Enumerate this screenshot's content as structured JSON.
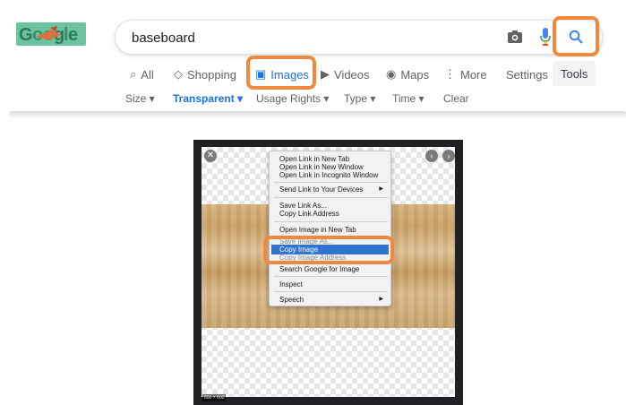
{
  "search": {
    "query": "baseboard"
  },
  "nav": {
    "all": "All",
    "shopping": "Shopping",
    "images": "Images",
    "videos": "Videos",
    "maps": "Maps",
    "more": "More",
    "settings": "Settings",
    "tools": "Tools"
  },
  "filters": {
    "size": "Size ▾",
    "transparent": "Transparent ▾",
    "usage_rights": "Usage Rights ▾",
    "type": "Type ▾",
    "time": "Time ▾",
    "clear": "Clear"
  },
  "context_menu": {
    "items": [
      "Open Link in New Tab",
      "Open Link in New Window",
      "Open Link in Incognito Window",
      "Send Link to Your Devices",
      "Save Link As...",
      "Copy Link Address",
      "Open Image in New Tab",
      "Save Image As...",
      "Copy Image",
      "Copy Image Address",
      "Search Google for Image",
      "Inspect",
      "Speech"
    ]
  },
  "viewer": {
    "dimensions": "600 × 600"
  },
  "colors": {
    "highlight": "#f0883e",
    "accent": "#1a73e8",
    "menu_selection": "#2f74d0"
  },
  "icons": [
    "search-icon",
    "camera-icon",
    "mic-icon",
    "close-icon",
    "chevron-left-icon",
    "chevron-right-icon",
    "image-icon",
    "video-icon",
    "map-pin-icon",
    "tag-icon"
  ]
}
